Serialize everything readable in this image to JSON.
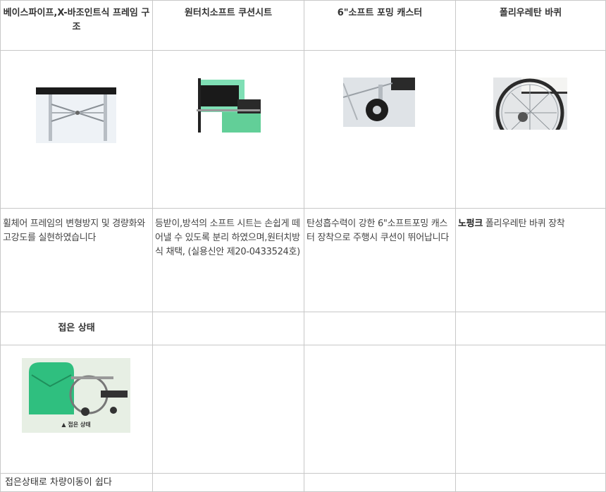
{
  "headers": [
    "베이스파이프,X-바조인트식 프레임 구조",
    "원터치소프트 쿠션시트",
    "6\"소프트 포밍 캐스터",
    "폴리우레탄 바퀴"
  ],
  "descriptions": [
    "휠체어 프레임의 변형방지 및 경량화와 고강도를 실현하였습니다",
    "등받이,방석의 소프트 시트는 손쉽게 떼어낼 수 있도록 분리 하였으며,원터치방식 채택, (실용신안 제20-0433524호)",
    "탄성흡수력이 강한 6\"소프트포밍 캐스터 장착으로 주행시 쿠션이 뛰어납니다",
    {
      "bold": "노펑크",
      "rest": " 폴리우레탄 바퀴 장착"
    }
  ],
  "folded": {
    "header": "접은 상태",
    "image_label": "▲ 접은 상태",
    "caption": "접은상태로 차량이동이 쉽다"
  },
  "images": [
    {
      "name": "x-bar-frame-photo",
      "bg": "#eef2f6"
    },
    {
      "name": "cushion-seat-photo",
      "bg": "#7fdfb5"
    },
    {
      "name": "caster-photo",
      "bg": "#dfe3e7"
    },
    {
      "name": "wheel-photo",
      "bg": "#e4e6e8"
    },
    {
      "name": "folded-wheelchair-photo",
      "bg": "#e7efe4",
      "accent": "#2fbf7f"
    }
  ]
}
